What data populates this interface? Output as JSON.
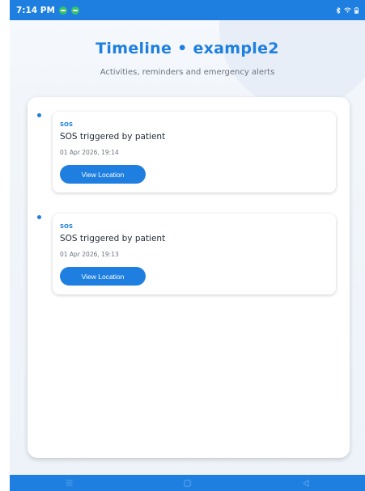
{
  "status_bar": {
    "time": "7:14 PM"
  },
  "header": {
    "title": "Timeline • example2",
    "subtitle": "Activities, reminders and emergency alerts"
  },
  "timeline": {
    "events": [
      {
        "type": "SOS",
        "title": "SOS triggered by patient",
        "time": "01 Apr 2026, 19:14",
        "action_label": "View Location"
      },
      {
        "type": "SOS",
        "title": "SOS triggered by patient",
        "time": "01 Apr 2026, 19:13",
        "action_label": "View Location"
      }
    ]
  },
  "icons": {
    "status": [
      "app-notification-icon",
      "app-notification-icon",
      "bluetooth-icon",
      "wifi-icon",
      "battery-icon"
    ],
    "nav": [
      "menu-icon",
      "home-icon",
      "back-icon"
    ]
  },
  "colors": {
    "accent": "#1e7fe0",
    "background": "#f2f6fb",
    "card": "#ffffff"
  }
}
